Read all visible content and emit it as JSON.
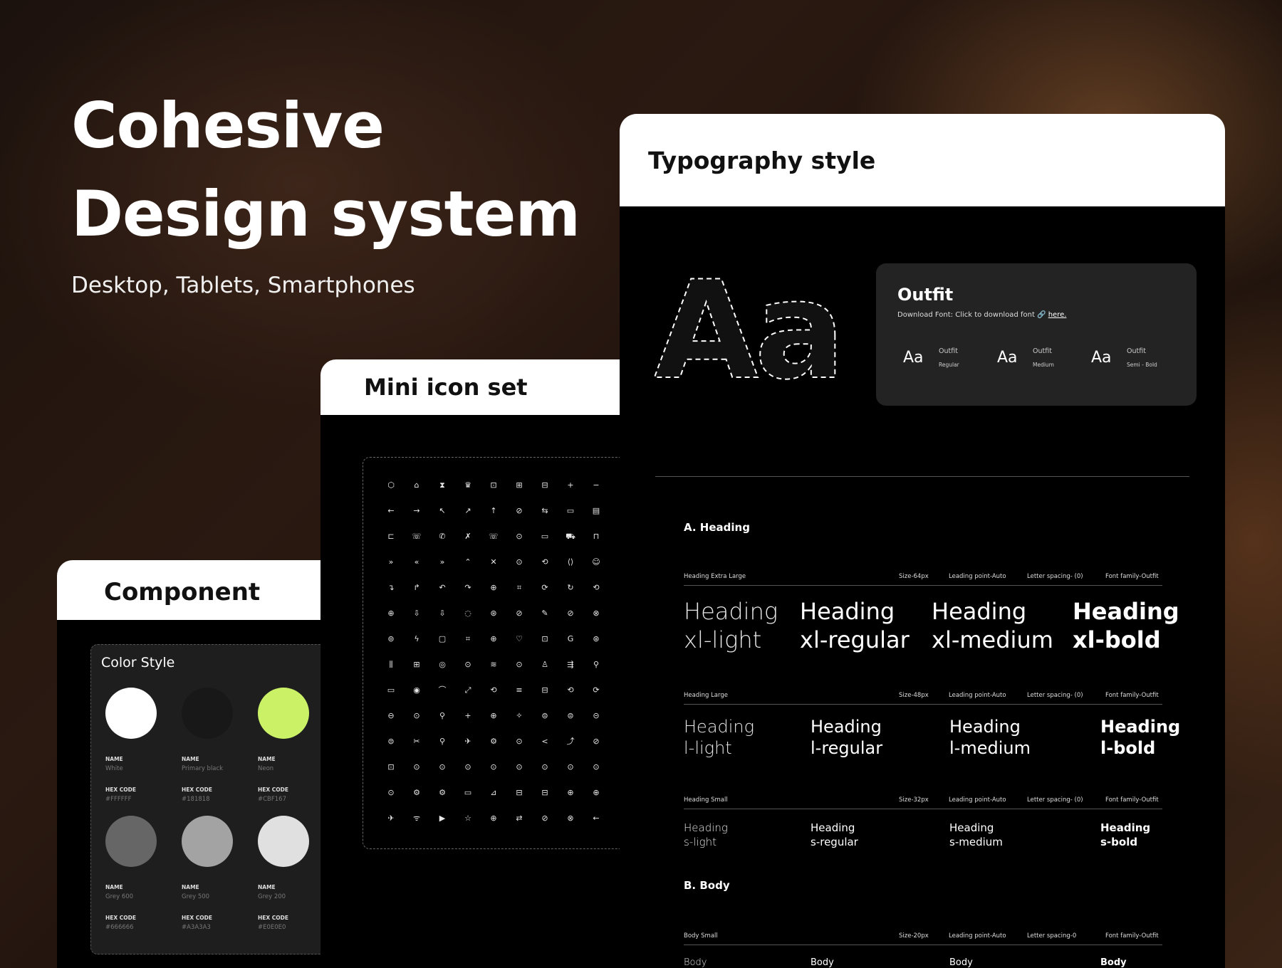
{
  "hero": {
    "title_line1": "Cohesive",
    "title_line2": "Design system",
    "subtitle": "Desktop, Tablets, Smartphones"
  },
  "component": {
    "title": "Component",
    "color_style": {
      "title": "Color Style",
      "name_label": "NAME",
      "hex_label": "HEX CODE",
      "swatches": [
        {
          "name": "White",
          "hex": "#FFFFFF",
          "color": "#FFFFFF"
        },
        {
          "name": "Primary black",
          "hex": "#181818",
          "color": "#181818"
        },
        {
          "name": "Neon",
          "hex": "#CBF167",
          "color": "#CBF167"
        },
        {
          "name": "Grey 600",
          "hex": "#666666",
          "color": "#666666"
        },
        {
          "name": "Grey 500",
          "hex": "#A3A3A3",
          "color": "#A3A3A3"
        },
        {
          "name": "Grey 200",
          "hex": "#E0E0E0",
          "color": "#E0E0E0"
        }
      ]
    }
  },
  "mini_icons": {
    "title": "Mini icon set",
    "rows": [
      [
        "⬡",
        "⌂",
        "⧗",
        "♛",
        "⊡",
        "⊞",
        "⊟",
        "+",
        "−",
        "·"
      ],
      [
        "←",
        "→",
        "↖",
        "↗",
        "↑",
        "⊘",
        "⇆",
        "▭",
        "▤",
        "·"
      ],
      [
        "⊏",
        "☏",
        "✆",
        "✗",
        "☏",
        "⊙",
        "▭",
        "⛟",
        "⊓",
        "·"
      ],
      [
        "»",
        "«",
        "»",
        "⌃",
        "✕",
        "⊙",
        "⟲",
        "⟨⟩",
        "☺",
        "·"
      ],
      [
        "↴",
        "↱",
        "↶",
        "↷",
        "⊕",
        "⌗",
        "⟳",
        "↻",
        "⟲",
        "·"
      ],
      [
        "⊕",
        "⇩",
        "⇩",
        "◌",
        "⊛",
        "⊘",
        "✎",
        "⊘",
        "⊗",
        "·"
      ],
      [
        "⊚",
        "ϟ",
        "▢",
        "⌗",
        "⊕",
        "♡",
        "⊡",
        "G",
        "⊛",
        "·"
      ],
      [
        "⫼",
        "⊞",
        "◎",
        "⊙",
        "≋",
        "⊙",
        "♙",
        "⇶",
        "⚲",
        "·"
      ],
      [
        "▭",
        "◉",
        "⌒",
        "⤢",
        "⟲",
        "≡",
        "⊟",
        "⟲",
        "⟳",
        "·"
      ],
      [
        "⊖",
        "⊙",
        "⚲",
        "+",
        "⊕",
        "✧",
        "⊜",
        "⊜",
        "⊝",
        "·"
      ],
      [
        "⊜",
        "✂",
        "⚲",
        "✈",
        "⚙",
        "⊙",
        "<",
        "⤴",
        "⊘",
        "·"
      ],
      [
        "⊡",
        "⊙",
        "⊙",
        "⊙",
        "⊙",
        "⊙",
        "⊙",
        "⊙",
        "⊙",
        "·"
      ],
      [
        "⊙",
        "⚙",
        "⚙",
        "▭",
        "⊿",
        "⊟",
        "⊟",
        "⊕",
        "⊕",
        "·"
      ],
      [
        "✈",
        "ᯤ",
        "▶",
        "☆",
        "⊕",
        "⇄",
        "⊘",
        "⊗",
        "←",
        "·"
      ]
    ]
  },
  "typography": {
    "title": "Typography style",
    "big_sample": "Aa",
    "font": {
      "name": "Outfit",
      "download_text": "Download Font: Click to download font 🔗",
      "link_text": "here.",
      "samples": [
        {
          "aa": "Aa",
          "family": "Outfit",
          "weight": "Regular"
        },
        {
          "aa": "Aa",
          "family": "Outfit",
          "weight": "Medium"
        },
        {
          "aa": "Aa",
          "family": "Outfit",
          "weight": "Semi - Bold"
        }
      ]
    },
    "heading_section": "A. Heading",
    "body_section": "B. Body",
    "groups": [
      {
        "label": "Heading Extra Large",
        "size": "Size-64px",
        "leading": "Leading point-Auto",
        "spacing": "Letter spacing- (0)",
        "family": "Font family-Outfit",
        "samples": [
          {
            "l1": "Heading",
            "l2": "xl-light"
          },
          {
            "l1": "Heading",
            "l2": "xl-regular"
          },
          {
            "l1": "Heading",
            "l2": "xl-medium"
          },
          {
            "l1": "Heading",
            "l2": "xl-bold"
          }
        ]
      },
      {
        "label": "Heading Large",
        "size": "Size-48px",
        "leading": "Leading point-Auto",
        "spacing": "Letter spacing- (0)",
        "family": "Font family-Outfit",
        "samples": [
          {
            "l1": "Heading",
            "l2": "l-light"
          },
          {
            "l1": "Heading",
            "l2": "l-regular"
          },
          {
            "l1": "Heading",
            "l2": "l-medium"
          },
          {
            "l1": "Heading",
            "l2": "l-bold"
          }
        ]
      },
      {
        "label": "Heading Small",
        "size": "Size-32px",
        "leading": "Leading point-Auto",
        "spacing": "Letter spacing- (0)",
        "family": "Font family-Outfit",
        "samples": [
          {
            "l1": "Heading",
            "l2": "s-light"
          },
          {
            "l1": "Heading",
            "l2": "s-regular"
          },
          {
            "l1": "Heading",
            "l2": "s-medium"
          },
          {
            "l1": "Heading",
            "l2": "s-bold"
          }
        ]
      },
      {
        "label": "Body Small",
        "size": "Size-20px",
        "leading": "Leading point-Auto",
        "spacing": "Letter spacing-0",
        "family": "Font family-Outfit",
        "samples": [
          {
            "l1": "Body",
            "l2": ""
          },
          {
            "l1": "Body",
            "l2": ""
          },
          {
            "l1": "Body",
            "l2": ""
          },
          {
            "l1": "Body",
            "l2": ""
          }
        ]
      }
    ]
  }
}
